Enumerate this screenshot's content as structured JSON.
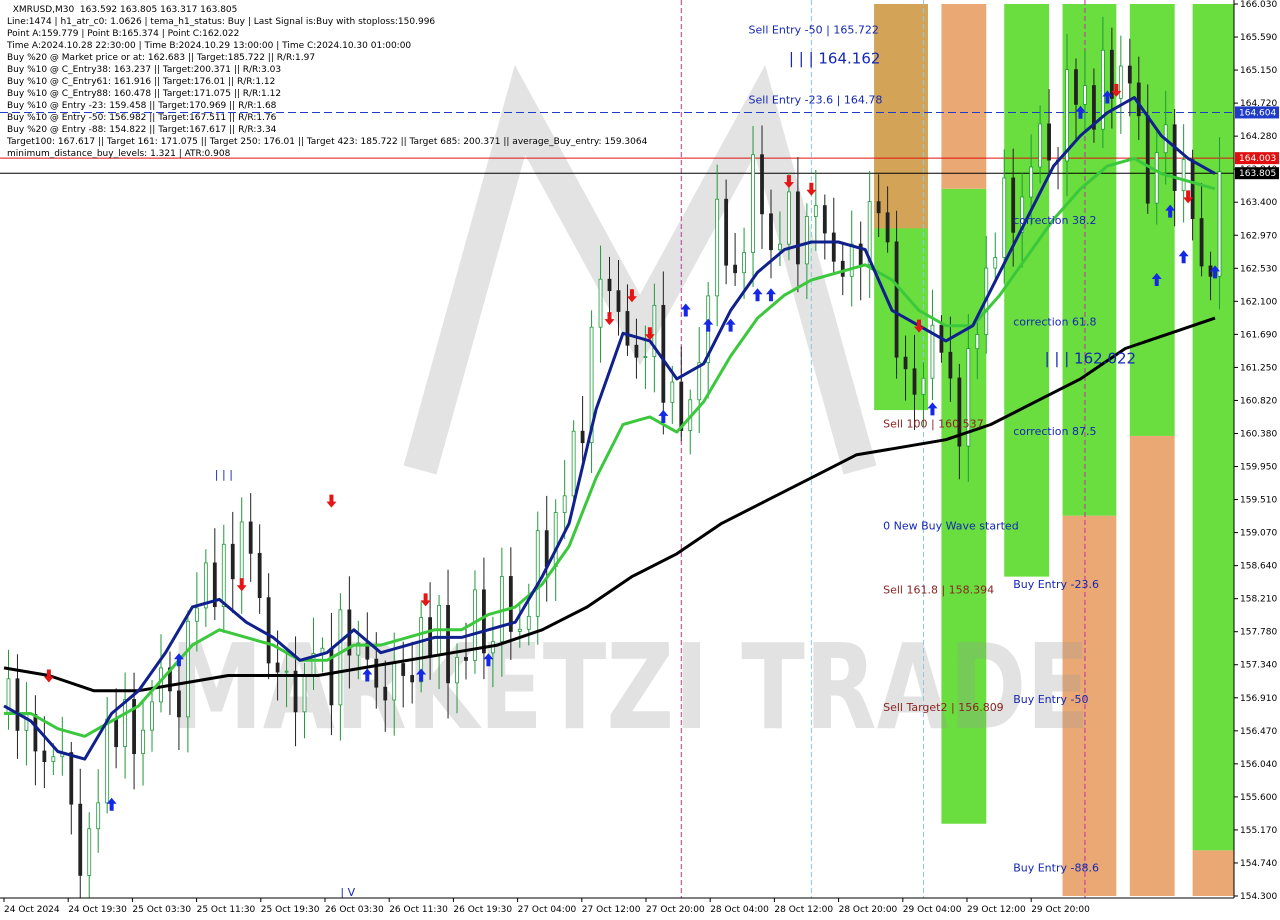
{
  "chart_data": {
    "type": "candlestick",
    "symbol_line": "XMRUSD,M30  163.592 163.805 163.317 163.805",
    "info_lines": [
      "Line:1474 | h1_atr_c0: 1.0626 | tema_h1_status: Buy | Last Signal is:Buy with stoploss:150.996",
      "Point A:159.779 | Point B:165.374 | Point C:162.022",
      "Time A:2024.10.28 22:30:00 | Time B:2024.10.29 13:00:00 | Time C:2024.10.30 01:00:00",
      "Buy %20 @ Market price or at: 162.683 || Target:185.722 || R/R:1.97",
      "Buy %10 @ C_Entry38: 163.237 || Target:200.371 || R/R:3.03",
      "Buy %10 @ C_Entry61: 161.916 || Target:176.01 || R/R:1.12",
      "Buy %10 @ C_Entry88: 160.478 || Target:171.075 || R/R:1.12",
      "Buy %10 @ Entry -23: 159.458 || Target:170.969 || R/R:1.68",
      "Buy %10 @ Entry -50: 156.982 || Target:167.511 || R/R:1.76",
      "Buy %20 @ Entry -88: 154.822 || Target:167.617 || R/R:3.34",
      "Target100: 167.617 || Target 161: 171.075 || Target 250: 176.01 || Target 423: 185.722 || Target 685: 200.371 || average_Buy_entry: 159.3064",
      "minimum_distance_buy_levels: 1.321 | ATR:0.908"
    ],
    "y_ticks": [
      "166.030",
      "165.590",
      "165.150",
      "164.720",
      "164.280",
      "163.840",
      "163.400",
      "162.970",
      "162.530",
      "162.100",
      "161.690",
      "161.250",
      "160.820",
      "160.380",
      "159.950",
      "159.510",
      "159.070",
      "158.640",
      "158.210",
      "157.780",
      "157.340",
      "156.910",
      "156.470",
      "156.040",
      "155.600",
      "155.170",
      "154.740",
      "154.300"
    ],
    "x_labels": [
      "24 Oct 2024",
      "24 Oct 19:30",
      "25 Oct 03:30",
      "25 Oct 11:30",
      "25 Oct 19:30",
      "26 Oct 03:30",
      "26 Oct 11:30",
      "26 Oct 19:30",
      "27 Oct 04:00",
      "27 Oct 12:00",
      "27 Oct 20:00",
      "28 Oct 04:00",
      "28 Oct 12:00",
      "28 Oct 20:00",
      "29 Oct 04:00",
      "29 Oct 12:00",
      "29 Oct 20:00"
    ],
    "ylim": [
      154.3,
      166.03
    ],
    "price_tags": [
      {
        "value": 164.604,
        "label": "164.604",
        "color": "#1e3cc8"
      },
      {
        "value": 164.003,
        "label": "164.003",
        "color": "#e01010"
      },
      {
        "value": 163.805,
        "label": "163.805",
        "color": "#000000"
      }
    ],
    "annotations": [
      {
        "text": "Sell Entry -50 | 165.722",
        "color": "#1428b4",
        "x": 166,
        "price": 165.64
      },
      {
        "text": "Sell Entry -23.6 | 164.78",
        "color": "#1428b4",
        "x": 166,
        "price": 164.72
      },
      {
        "text": "| | | 164.162",
        "color": "#1428b4",
        "x": 175,
        "price": 165.25,
        "big": true
      },
      {
        "text": "correction 38.2",
        "color": "#1428b4",
        "x": 225,
        "price": 163.14
      },
      {
        "text": "correction 61.8",
        "color": "#1428b4",
        "x": 225,
        "price": 161.8
      },
      {
        "text": "| | | 162.022",
        "color": "#1428b4",
        "x": 232,
        "price": 161.3,
        "big": true
      },
      {
        "text": "Sell 100 | 160.537",
        "color": "#8b2424",
        "x": 196,
        "price": 160.46
      },
      {
        "text": "correction 87.5",
        "color": "#1428b4",
        "x": 225,
        "price": 160.36
      },
      {
        "text": "0 New Buy Wave started",
        "color": "#1428b4",
        "x": 196,
        "price": 159.12
      },
      {
        "text": "Sell 161.8 | 158.394",
        "color": "#8b2424",
        "x": 196,
        "price": 158.28
      },
      {
        "text": "Buy Entry -23.6",
        "color": "#1428b4",
        "x": 225,
        "price": 158.35
      },
      {
        "text": "Buy Entry -50",
        "color": "#1428b4",
        "x": 225,
        "price": 156.84
      },
      {
        "text": "Sell Target2 | 156.809",
        "color": "#8b2424",
        "x": 196,
        "price": 156.73
      },
      {
        "text": "Buy Entry -88.6",
        "color": "#1428b4",
        "x": 225,
        "price": 154.62
      },
      {
        "text": "| | |",
        "color": "#1428b4",
        "x": 47,
        "price": 159.8
      },
      {
        "text": "| V",
        "color": "#1428b4",
        "x": 75,
        "price": 154.3
      }
    ],
    "zones": [
      {
        "x0": 194,
        "x1": 206,
        "top": 166.03,
        "bottom": 160.69,
        "color": "#4fd81c"
      },
      {
        "x0": 194,
        "x1": 206,
        "top": 166.03,
        "bottom": 163.08,
        "color": "#e69a5c"
      },
      {
        "x0": 209,
        "x1": 219,
        "top": 163.6,
        "bottom": 155.25,
        "color": "#4fd81c"
      },
      {
        "x0": 209,
        "x1": 219,
        "top": 166.03,
        "bottom": 163.6,
        "color": "#e69a5c"
      },
      {
        "x0": 223,
        "x1": 233,
        "top": 166.03,
        "bottom": 158.5,
        "color": "#4fd81c"
      },
      {
        "x0": 236,
        "x1": 248,
        "top": 166.03,
        "bottom": 159.3,
        "color": "#4fd81c"
      },
      {
        "x0": 236,
        "x1": 248,
        "top": 159.3,
        "bottom": 154.3,
        "color": "#e69a5c"
      },
      {
        "x0": 251,
        "x1": 261,
        "top": 166.03,
        "bottom": 160.35,
        "color": "#4fd81c"
      },
      {
        "x0": 251,
        "x1": 261,
        "top": 160.35,
        "bottom": 154.3,
        "color": "#e69a5c"
      },
      {
        "x0": 265,
        "x1": 275,
        "top": 166.03,
        "bottom": 154.9,
        "color": "#4fd81c"
      },
      {
        "x0": 265,
        "x1": 275,
        "top": 154.9,
        "bottom": 154.3,
        "color": "#e69a5c"
      }
    ],
    "close_path": [
      [
        0,
        156.7
      ],
      [
        3,
        156.9
      ],
      [
        6,
        156.3
      ],
      [
        9,
        156.0
      ],
      [
        12,
        156.5
      ],
      [
        15,
        155.3
      ],
      [
        18,
        154.7
      ],
      [
        21,
        155.6
      ],
      [
        24,
        156.8
      ],
      [
        27,
        156.5
      ],
      [
        30,
        156.2
      ],
      [
        33,
        157.0
      ],
      [
        36,
        157.1
      ],
      [
        39,
        156.9
      ],
      [
        42,
        158.0
      ],
      [
        45,
        158.6
      ],
      [
        48,
        158.3
      ],
      [
        51,
        158.8
      ],
      [
        54,
        159.3
      ],
      [
        57,
        158.0
      ],
      [
        60,
        157.4
      ],
      [
        63,
        157.0
      ],
      [
        66,
        156.9
      ],
      [
        69,
        157.6
      ],
      [
        72,
        157.0
      ],
      [
        75,
        157.8
      ],
      [
        78,
        157.4
      ],
      [
        81,
        157.7
      ],
      [
        84,
        156.4
      ],
      [
        87,
        157.6
      ],
      [
        90,
        156.8
      ],
      [
        93,
        157.8
      ],
      [
        96,
        157.9
      ],
      [
        99,
        157.3
      ],
      [
        102,
        157.4
      ],
      [
        105,
        158.0
      ],
      [
        108,
        157.5
      ],
      [
        111,
        158.3
      ],
      [
        114,
        157.6
      ],
      [
        117,
        158.2
      ],
      [
        120,
        158.9
      ],
      [
        123,
        159.2
      ],
      [
        126,
        159.9
      ],
      [
        129,
        160.6
      ],
      [
        132,
        162.2
      ],
      [
        135,
        162.4
      ],
      [
        138,
        161.8
      ],
      [
        141,
        161.1
      ],
      [
        144,
        162.2
      ],
      [
        147,
        160.9
      ],
      [
        150,
        160.9
      ],
      [
        153,
        160.5
      ],
      [
        156,
        161.8
      ],
      [
        159,
        163.4
      ],
      [
        162,
        162.1
      ],
      [
        165,
        163.1
      ],
      [
        168,
        163.9
      ],
      [
        171,
        162.7
      ],
      [
        174,
        163.3
      ],
      [
        177,
        162.9
      ],
      [
        180,
        163.4
      ],
      [
        183,
        163.0
      ],
      [
        186,
        162.6
      ],
      [
        189,
        162.5
      ],
      [
        192,
        163.2
      ],
      [
        195,
        163.4
      ],
      [
        198,
        162.2
      ],
      [
        201,
        161.0
      ],
      [
        204,
        160.8
      ],
      [
        207,
        161.9
      ],
      [
        210,
        161.1
      ],
      [
        213,
        160.6
      ],
      [
        216,
        161.5
      ],
      [
        219,
        162.4
      ],
      [
        222,
        163.4
      ],
      [
        225,
        163.2
      ],
      [
        228,
        163.7
      ],
      [
        231,
        164.3
      ],
      [
        234,
        163.9
      ],
      [
        237,
        164.8
      ],
      [
        240,
        165.0
      ],
      [
        243,
        164.6
      ],
      [
        246,
        165.2
      ],
      [
        249,
        165.1
      ],
      [
        252,
        164.9
      ],
      [
        255,
        163.6
      ],
      [
        258,
        164.3
      ],
      [
        261,
        163.9
      ],
      [
        264,
        163.8
      ],
      [
        267,
        162.3
      ],
      [
        270,
        163.2
      ],
      [
        272,
        163.8
      ]
    ],
    "ma_blue": [
      [
        0,
        156.8
      ],
      [
        6,
        156.6
      ],
      [
        12,
        156.2
      ],
      [
        18,
        156.1
      ],
      [
        24,
        156.7
      ],
      [
        30,
        157.0
      ],
      [
        36,
        157.5
      ],
      [
        42,
        158.1
      ],
      [
        48,
        158.2
      ],
      [
        54,
        157.9
      ],
      [
        60,
        157.7
      ],
      [
        66,
        157.4
      ],
      [
        72,
        157.5
      ],
      [
        78,
        157.8
      ],
      [
        84,
        157.5
      ],
      [
        90,
        157.6
      ],
      [
        96,
        157.7
      ],
      [
        102,
        157.7
      ],
      [
        108,
        157.8
      ],
      [
        114,
        157.9
      ],
      [
        120,
        158.5
      ],
      [
        126,
        159.2
      ],
      [
        132,
        160.7
      ],
      [
        138,
        161.7
      ],
      [
        144,
        161.6
      ],
      [
        150,
        161.1
      ],
      [
        156,
        161.3
      ],
      [
        162,
        162.0
      ],
      [
        168,
        162.5
      ],
      [
        174,
        162.8
      ],
      [
        180,
        162.9
      ],
      [
        186,
        162.9
      ],
      [
        192,
        162.8
      ],
      [
        198,
        162.0
      ],
      [
        204,
        161.8
      ],
      [
        210,
        161.6
      ],
      [
        216,
        161.8
      ],
      [
        222,
        162.5
      ],
      [
        228,
        163.2
      ],
      [
        234,
        163.9
      ],
      [
        240,
        164.3
      ],
      [
        246,
        164.6
      ],
      [
        252,
        164.8
      ],
      [
        258,
        164.3
      ],
      [
        264,
        164.0
      ],
      [
        270,
        163.8
      ]
    ],
    "ma_green": [
      [
        0,
        156.7
      ],
      [
        6,
        156.7
      ],
      [
        12,
        156.5
      ],
      [
        18,
        156.4
      ],
      [
        24,
        156.6
      ],
      [
        30,
        156.8
      ],
      [
        36,
        157.2
      ],
      [
        42,
        157.6
      ],
      [
        48,
        157.8
      ],
      [
        54,
        157.7
      ],
      [
        60,
        157.6
      ],
      [
        66,
        157.4
      ],
      [
        72,
        157.4
      ],
      [
        78,
        157.6
      ],
      [
        84,
        157.6
      ],
      [
        90,
        157.7
      ],
      [
        96,
        157.8
      ],
      [
        102,
        157.8
      ],
      [
        108,
        158.0
      ],
      [
        114,
        158.1
      ],
      [
        120,
        158.4
      ],
      [
        126,
        158.9
      ],
      [
        132,
        159.8
      ],
      [
        138,
        160.5
      ],
      [
        144,
        160.6
      ],
      [
        150,
        160.4
      ],
      [
        156,
        160.8
      ],
      [
        162,
        161.4
      ],
      [
        168,
        161.9
      ],
      [
        174,
        162.2
      ],
      [
        180,
        162.4
      ],
      [
        186,
        162.5
      ],
      [
        192,
        162.6
      ],
      [
        198,
        162.4
      ],
      [
        204,
        162.0
      ],
      [
        210,
        161.8
      ],
      [
        216,
        161.8
      ],
      [
        222,
        162.2
      ],
      [
        228,
        162.7
      ],
      [
        234,
        163.2
      ],
      [
        240,
        163.6
      ],
      [
        246,
        163.9
      ],
      [
        252,
        164.0
      ],
      [
        258,
        163.8
      ],
      [
        264,
        163.7
      ],
      [
        270,
        163.6
      ]
    ],
    "ma_black": [
      [
        0,
        157.3
      ],
      [
        10,
        157.2
      ],
      [
        20,
        157.0
      ],
      [
        30,
        157.0
      ],
      [
        40,
        157.1
      ],
      [
        50,
        157.2
      ],
      [
        60,
        157.2
      ],
      [
        70,
        157.2
      ],
      [
        80,
        157.3
      ],
      [
        90,
        157.4
      ],
      [
        100,
        157.5
      ],
      [
        110,
        157.6
      ],
      [
        120,
        157.8
      ],
      [
        130,
        158.1
      ],
      [
        140,
        158.5
      ],
      [
        150,
        158.8
      ],
      [
        160,
        159.2
      ],
      [
        170,
        159.5
      ],
      [
        180,
        159.8
      ],
      [
        190,
        160.1
      ],
      [
        200,
        160.2
      ],
      [
        210,
        160.3
      ],
      [
        220,
        160.5
      ],
      [
        230,
        160.8
      ],
      [
        240,
        161.1
      ],
      [
        250,
        161.5
      ],
      [
        260,
        161.7
      ],
      [
        270,
        161.9
      ]
    ],
    "buy_arrows": [
      [
        24,
        155.5
      ],
      [
        39,
        157.4
      ],
      [
        81,
        157.2
      ],
      [
        93,
        157.2
      ],
      [
        108,
        157.4
      ],
      [
        147,
        160.6
      ],
      [
        152,
        162.0
      ],
      [
        157,
        161.8
      ],
      [
        162,
        161.8
      ],
      [
        168,
        162.2
      ],
      [
        171,
        162.2
      ],
      [
        207,
        160.7
      ],
      [
        240,
        164.6
      ],
      [
        246,
        164.8
      ],
      [
        257,
        162.4
      ],
      [
        260,
        163.3
      ],
      [
        263,
        162.7
      ],
      [
        270,
        162.5
      ]
    ],
    "sell_arrows": [
      [
        10,
        157.2
      ],
      [
        53,
        158.4
      ],
      [
        73,
        159.5
      ],
      [
        94,
        158.2
      ],
      [
        135,
        161.9
      ],
      [
        140,
        162.2
      ],
      [
        144,
        161.7
      ],
      [
        175,
        163.7
      ],
      [
        180,
        163.6
      ],
      [
        204,
        161.8
      ],
      [
        248,
        164.9
      ],
      [
        264,
        163.5
      ]
    ],
    "v_lines": [
      {
        "x": 151,
        "color": "#c0309c"
      },
      {
        "x": 180,
        "color": "#8cc8dc"
      },
      {
        "x": 205,
        "color": "#8cc8dc"
      },
      {
        "x": 241,
        "color": "#c0309c"
      }
    ],
    "h_lines": [
      {
        "value": 164.604,
        "color": "#1e3cc8",
        "dash": "8,4"
      },
      {
        "value": 164.003,
        "color": "#e01010",
        "dash": ""
      },
      {
        "value": 163.805,
        "color": "#000000",
        "dash": ""
      }
    ],
    "watermark": "MARKETZI TRADE"
  }
}
